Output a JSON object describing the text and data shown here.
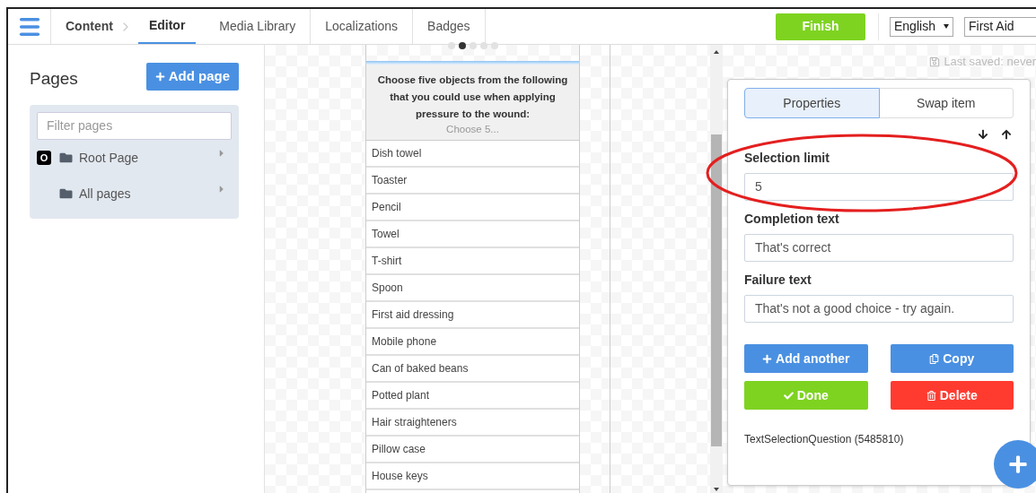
{
  "nav": {
    "breadcrumb": "Content",
    "tabs": [
      {
        "label": "Editor",
        "selected": true
      },
      {
        "label": "Media Library",
        "selected": false
      },
      {
        "label": "Localizations",
        "selected": false
      },
      {
        "label": "Badges",
        "selected": false
      }
    ],
    "finish": "Finish",
    "language": "English",
    "app": "First Aid"
  },
  "pages": {
    "title": "Pages",
    "add_button": "Add page",
    "filter_placeholder": "Filter pages",
    "tree": [
      {
        "label": "Root Page",
        "badge": "O"
      },
      {
        "label": "All pages"
      }
    ]
  },
  "preview": {
    "dots": [
      {
        "selected": false
      },
      {
        "selected": true
      },
      {
        "selected": false
      },
      {
        "selected": false
      },
      {
        "selected": false
      }
    ],
    "question": "Choose five objects from the following that you could use when applying pressure to the wound:",
    "hint": "Choose 5...",
    "options": [
      "Dish towel",
      "Toaster",
      "Pencil",
      "Towel",
      "T-shirt",
      "Spoon",
      "First aid dressing",
      "Mobile phone",
      "Can of baked beans",
      "Potted plant",
      "Hair straighteners",
      "Pillow case",
      "House keys"
    ]
  },
  "inspector": {
    "last_saved": "Last saved: never",
    "tabs": [
      {
        "label": "Properties",
        "selected": true
      },
      {
        "label": "Swap item",
        "selected": false
      }
    ],
    "fields": [
      {
        "label": "Selection limit",
        "value": "5",
        "highlighted": true
      },
      {
        "label": "Completion text",
        "value": "That's correct",
        "highlighted": false
      },
      {
        "label": "Failure text",
        "value": "That's not a good choice - try again.",
        "highlighted": false
      }
    ],
    "buttons": [
      {
        "label": "Add another",
        "kind": "add"
      },
      {
        "label": "Copy",
        "kind": "copy"
      },
      {
        "label": "Done",
        "kind": "done"
      },
      {
        "label": "Delete",
        "kind": "delete"
      }
    ],
    "item_type": "TextSelectionQuestion (5485810)"
  }
}
